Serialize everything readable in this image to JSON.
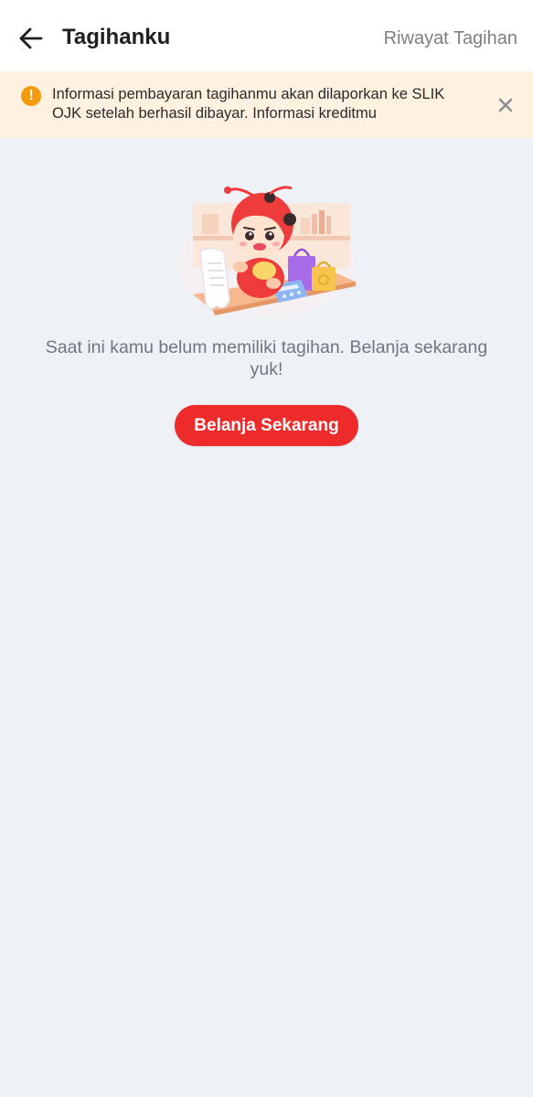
{
  "header": {
    "title": "Tagihanku",
    "history_link": "Riwayat Tagihan",
    "back_icon": "arrow-left-icon"
  },
  "notice": {
    "icon": "exclamation-icon",
    "text": "Informasi pembayaran tagihanmu akan dilaporkan ke SLIK OJK setelah berhasil dibayar. Informasi kreditmu",
    "close_icon": "close-icon",
    "background_color": "#FFF1E0",
    "icon_color": "#F59A0C"
  },
  "empty_state": {
    "illustration": "ladybug-mascot-shopping-illustration",
    "message": "Saat ini kamu belum memiliki tagihan. Belanja sekarang yuk!",
    "button_label": "Belanja Sekarang",
    "button_color": "#EE2B2B"
  },
  "colors": {
    "page_background": "#EEF1F6",
    "header_background": "#FFFFFF"
  }
}
